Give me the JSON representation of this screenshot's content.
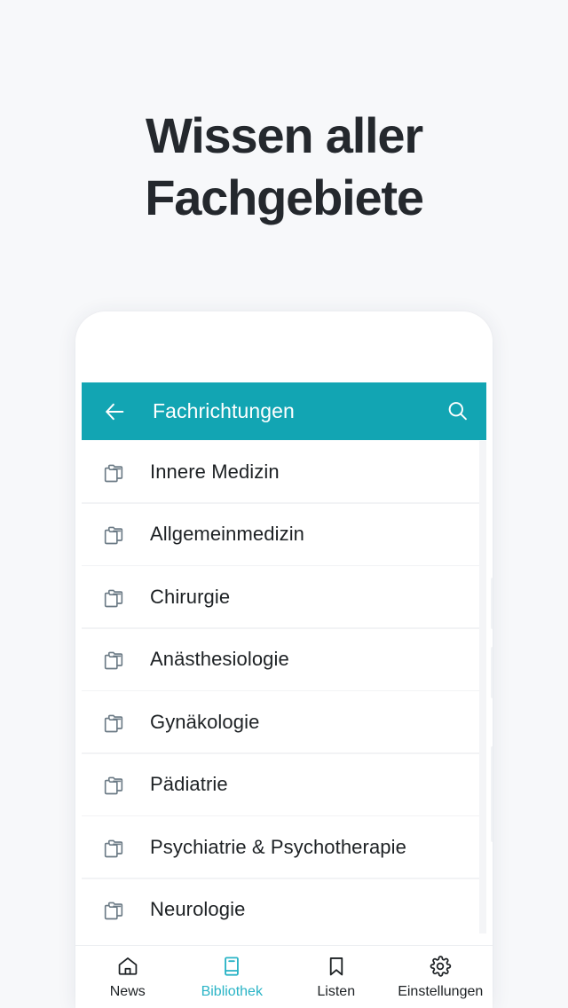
{
  "page": {
    "background_color": "#f7f8fa",
    "headline_line1": "Wissen aller",
    "headline_line2": "Fachgebiete",
    "headline_color": "#24282d"
  },
  "app": {
    "accent_color": "#12a5b3",
    "active_nav_color": "#2ab4c6",
    "appbar": {
      "title": "Fachrichtungen",
      "back_icon": "arrow-left-icon",
      "search_icon": "search-icon"
    },
    "list": {
      "row_icon": "stacked-folders-icon",
      "items": [
        {
          "label": "Innere Medizin"
        },
        {
          "label": "Allgemeinmedizin"
        },
        {
          "label": "Chirurgie"
        },
        {
          "label": "Anästhesiologie"
        },
        {
          "label": "Gynäkologie"
        },
        {
          "label": "Pädiatrie"
        },
        {
          "label": "Psychiatrie & Psychotherapie"
        },
        {
          "label": "Neurologie"
        }
      ]
    },
    "bottom_nav": {
      "items": [
        {
          "label": "News",
          "icon": "home-icon",
          "active": false
        },
        {
          "label": "Bibliothek",
          "icon": "book-icon",
          "active": true
        },
        {
          "label": "Listen",
          "icon": "bookmark-icon",
          "active": false
        },
        {
          "label": "Einstellungen",
          "icon": "gear-icon",
          "active": false
        }
      ]
    }
  }
}
